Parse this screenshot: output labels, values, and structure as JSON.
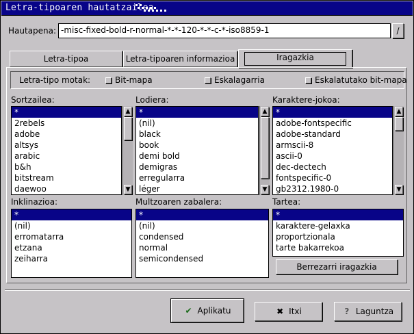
{
  "window": {
    "title": "Letra-tipoaren hautatzailea"
  },
  "search": {
    "label": "Hautapena:",
    "value": "-misc-fixed-bold-r-normal-*-*-120-*-*-c-*-iso8859-1",
    "browse_label": "/"
  },
  "tabs": [
    {
      "label": "Letra-tipoa"
    },
    {
      "label": "Letra-tipoaren informazioa"
    },
    {
      "label": "Iragazkia"
    }
  ],
  "font_types": {
    "label": "Letra-tipo motak:",
    "options": [
      {
        "label": "Bit-mapa"
      },
      {
        "label": "Eskalagarria"
      },
      {
        "label": "Eskalatutako bit-mapa"
      }
    ]
  },
  "lists": {
    "foundry": {
      "label": "Sortzailea:",
      "items": [
        "*",
        "2rebels",
        "adobe",
        "altsys",
        "arabic",
        "b&h",
        "bitstream",
        "daewoo"
      ]
    },
    "weight": {
      "label": "Lodiera:",
      "items": [
        "*",
        "(nil)",
        "black",
        "book",
        "demi bold",
        "demigras",
        "erregularra",
        "léger"
      ]
    },
    "charset": {
      "label": "Karaktere-jokoa:",
      "items": [
        "*",
        "adobe-fontspecific",
        "adobe-standard",
        "armscii-8",
        "ascii-0",
        "dec-dectech",
        "fontspecific-0",
        "gb2312.1980-0"
      ]
    },
    "slant": {
      "label": "Inklinazioa:",
      "items": [
        "*",
        "(nil)",
        "erromatarra",
        "etzana",
        "zeiharra"
      ]
    },
    "setwidth": {
      "label": "Multzoaren zabalera:",
      "items": [
        "*",
        "(nil)",
        "condensed",
        "normal",
        "semicondensed"
      ]
    },
    "spacing": {
      "label": "Tartea:",
      "items": [
        "*",
        "karaktere-gelaxka",
        "proportzionala",
        "tarte bakarrekoa"
      ]
    }
  },
  "reset_button": {
    "label": "Berrezarri iragazkia"
  },
  "buttons": {
    "apply": "Aplikatu",
    "close": "Itxi",
    "help": "Laguntza"
  },
  "colors": {
    "selection": "#080488",
    "titlebar": "#080488",
    "background": "#c6c3c6"
  }
}
